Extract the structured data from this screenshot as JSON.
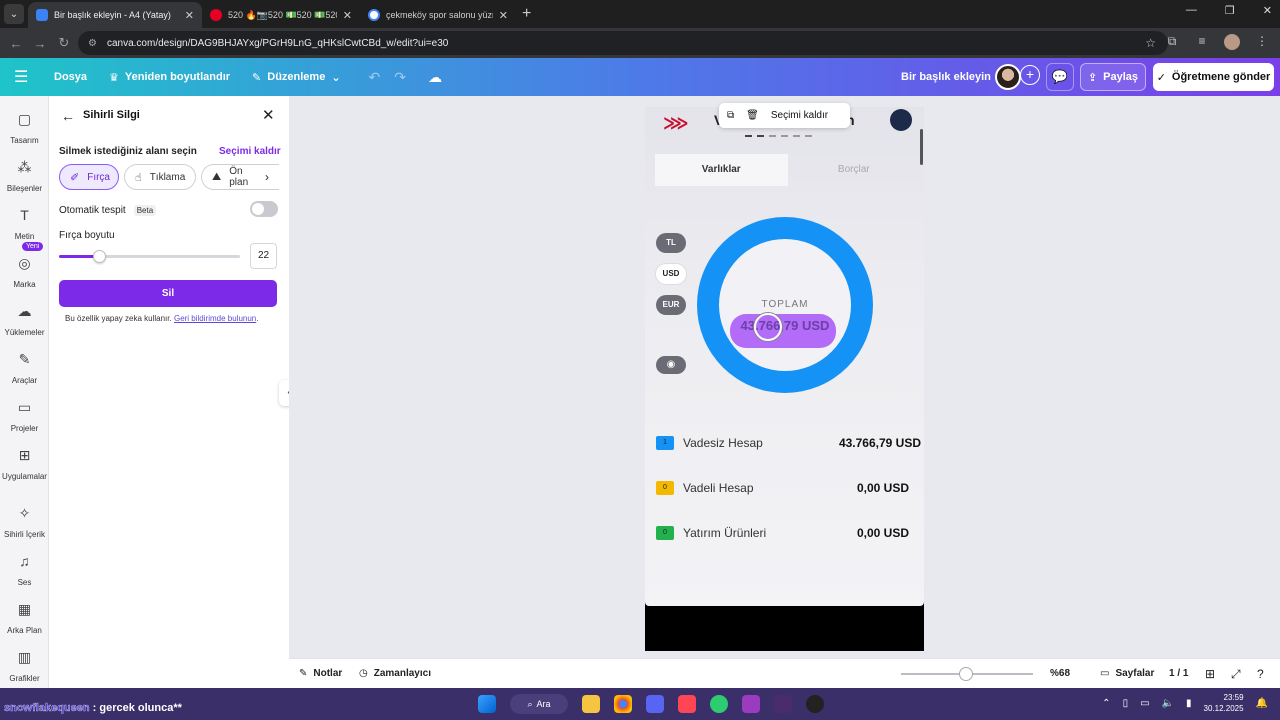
{
  "browser": {
    "tabs": [
      {
        "label": "Bir başlık ekleyin - A4 (Yatay)",
        "active": true,
        "favicon_color": "#3b82f6"
      },
      {
        "label": "520 🔥📷520 💵520 💵520 💵",
        "active": false,
        "favicon_color": "#e60023"
      },
      {
        "label": "çekmeköy spor salonu yüzme",
        "active": false,
        "favicon_color": "#4285f4"
      }
    ],
    "url": "canva.com/design/DAG9BHJAYxg/PGrH9LnG_qHKslCwtCBd_w/edit?ui=e30"
  },
  "header": {
    "file": "Dosya",
    "resize": "Yeniden boyutlandır",
    "edit": "Düzenleme",
    "design_title": "Bir başlık ekleyin",
    "share": "Paylaş",
    "send_teacher": "Öğretmene gönder",
    "gradient_colors": [
      "#1fc4c9",
      "#4d7ae8",
      "#7a3fe9"
    ]
  },
  "rail": {
    "badge": "Yeni",
    "items": [
      {
        "label": "Tasarım",
        "icon": "layout-icon"
      },
      {
        "label": "Bileşenler",
        "icon": "shapes-icon"
      },
      {
        "label": "Metin",
        "icon": "text-icon"
      },
      {
        "label": "Marka",
        "icon": "brand-icon"
      },
      {
        "label": "Yüklemeler",
        "icon": "upload-cloud-icon"
      },
      {
        "label": "Araçlar",
        "icon": "pen-tool-icon"
      },
      {
        "label": "Projeler",
        "icon": "folder-icon"
      },
      {
        "label": "Uygulamalar",
        "icon": "apps-icon"
      },
      {
        "label": "Sihirli İçerik",
        "icon": "magic-media-icon"
      },
      {
        "label": "Ses",
        "icon": "music-icon"
      },
      {
        "label": "Arka Plan",
        "icon": "background-icon"
      },
      {
        "label": "Grafikler",
        "icon": "charts-icon"
      }
    ]
  },
  "panel": {
    "title": "Sihirli Silgi",
    "select_area": "Silmek istediğiniz alanı seçin",
    "clear_selection": "Seçimi kaldır",
    "modes": [
      "Fırça",
      "Tıklama",
      "Ön plan"
    ],
    "auto_detect": "Otomatik tespit",
    "beta": "Beta",
    "brush_size_label": "Fırça boyutu",
    "brush_size": "22",
    "brush_size_fraction": 0.22,
    "erase": "Sil",
    "disclaimer": "Bu özellik yapay zeka kullanır.",
    "feedback_link": "Geri bildirimde bulunun",
    "accent": "#7d2ae8"
  },
  "selection_toolbar": {
    "clear": "Seçimi kaldır"
  },
  "phone": {
    "title_left": "V",
    "title_right": "n",
    "tab_assets": "Varlıklar",
    "tab_debts": "Borçlar",
    "currencies": [
      "TL",
      "USD",
      "EUR"
    ],
    "total_label": "TOPLAM",
    "total_value": "43.766,79 USD",
    "donut_color": "#1592f5",
    "accounts": [
      {
        "badge": "1",
        "name": "Vadesiz Hesap",
        "amount": "43.766,79 USD",
        "badge_color": "#1592f5"
      },
      {
        "badge": "0",
        "name": "Vadeli Hesap",
        "amount": "0,00 USD",
        "badge_color": "#f5b800"
      },
      {
        "badge": "0",
        "name": "Yatırım Ürünleri",
        "amount": "0,00 USD",
        "badge_color": "#22b14c"
      }
    ]
  },
  "bottombar": {
    "notes": "Notlar",
    "timer": "Zamanlayıcı",
    "zoom": "%68",
    "pages": "Sayfalar",
    "page_count": "1 / 1"
  },
  "taskbar": {
    "overlay_user": "snowflakequeen",
    "overlay_msg": ": gercek olunca**",
    "search": "Ara",
    "time": "23:59",
    "date": "30.12.2025"
  }
}
